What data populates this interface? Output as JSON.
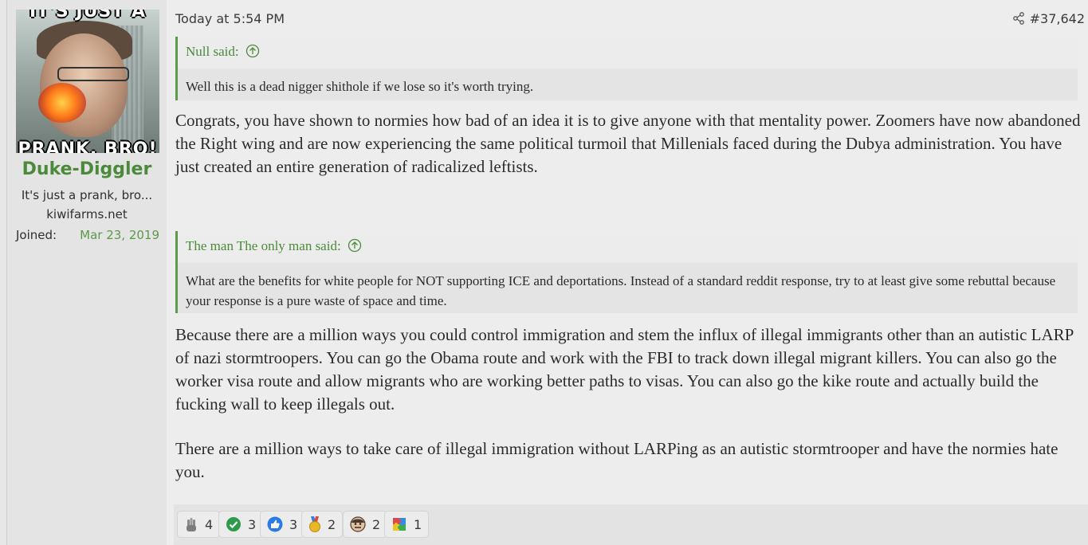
{
  "user": {
    "name": "Duke-Diggler",
    "title": "It's just a prank, bro...",
    "site": "kiwifarms.net",
    "joined_label": "Joined:",
    "joined_date": "Mar 23, 2019",
    "avatar_caption_top": "IT'S JUST A",
    "avatar_caption_bottom": "PRANK, BRO!"
  },
  "post": {
    "date": "Today at 5:54 PM",
    "number": "#37,642",
    "quotes": [
      {
        "author": "Null said:",
        "text": "Well this is a dead nigger shithole if we lose so it's worth trying."
      },
      {
        "author": "The man The only man said:",
        "text": "What are the benefits for white people for NOT supporting ICE and deportations. Instead of a standard reddit response, try to at least give some rebuttal because your response is a pure waste of space and time."
      }
    ],
    "paragraphs": [
      "Congrats, you have shown to normies how bad of an idea it is to give anyone with that mentality power. Zoomers have now abandoned the Right wing and are now experiencing the same political turmoil that Millenials faced during the Dubya administration. You have just created an entire generation of radicalized leftists.",
      "Because there are a million ways you could control immigration and stem the influx of illegal immigrants other than an autistic LARP of nazi stormtroopers. You can go the Obama route and work with the FBI to track down illegal migrant killers. You can also go the worker visa route and allow migrants who are working better paths to visas. You can also go the kike route and actually build the fucking wall to keep illegals out.",
      "There are a million ways to take care of illegal immigration without LARPing as an autistic stormtrooper and have the normies hate you."
    ]
  },
  "reactions": [
    {
      "icon": "hand-icon",
      "count": "4"
    },
    {
      "icon": "checkmark-icon",
      "count": "3"
    },
    {
      "icon": "thumbs-up-icon",
      "count": "3"
    },
    {
      "icon": "medal-icon",
      "count": "2"
    },
    {
      "icon": "face-icon",
      "count": "2"
    },
    {
      "icon": "puzzle-icon",
      "count": "1"
    }
  ],
  "colors": {
    "accent": "#4a8a3a",
    "date_green": "#5b9a49",
    "background": "#ededed"
  }
}
